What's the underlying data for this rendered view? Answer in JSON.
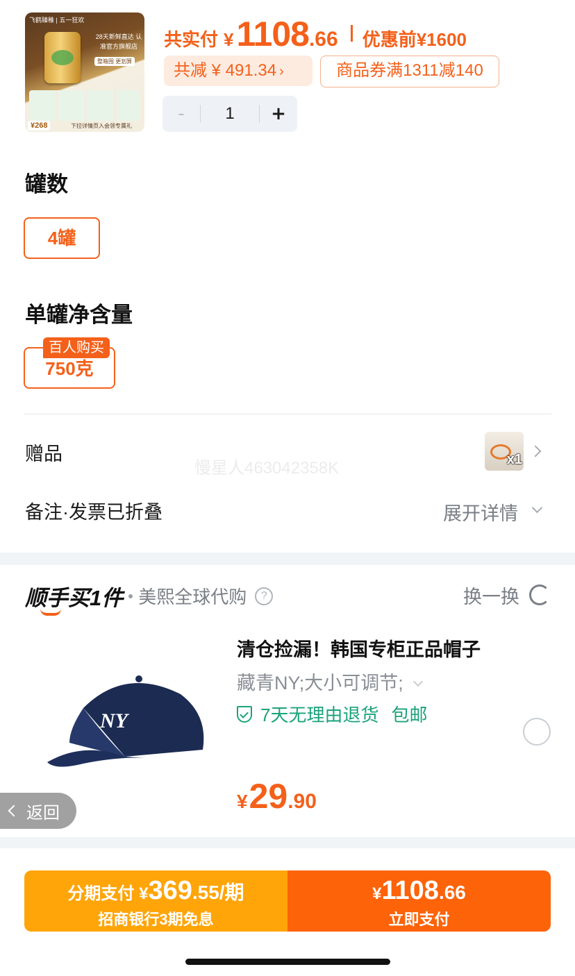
{
  "product_thumb": {
    "brand": "飞鹤臻稚 | 五一狂欢",
    "slogan": "28天新鲜直达 认准官方旗舰店",
    "flag": "整箱囤 更划算",
    "price_tag": "¥268",
    "footer": "下拉详情页入会领专属礼"
  },
  "summary": {
    "paid_label": "共实付",
    "currency": "¥",
    "paid_integer": "1108",
    "paid_decimal": ".66",
    "original_label": "优惠前",
    "original_price": "¥1600",
    "savings": "共减 ¥ 491.34",
    "coupon": "商品券满1311减140",
    "quantity": "1",
    "minus": "-",
    "plus": "+"
  },
  "specs": {
    "count_title": "罐数",
    "count_option": "4罐",
    "weight_title": "单罐净含量",
    "weight_option": "750克",
    "weight_badge": "百人购买"
  },
  "gift": {
    "label": "赠品",
    "quantity": "x1",
    "watermark": "慢星人463042358K"
  },
  "note": {
    "label": "备注·发票已折叠",
    "action": "展开详情"
  },
  "bundle": {
    "title": "顺手买1件",
    "shop": "美熙全球代购",
    "help": "?",
    "swap": "换一换",
    "item": {
      "name": "清仓捡漏！韩国专柜正品帽子",
      "spec": "藏青NY;大小可调节;",
      "return_policy": "7天无理由退货",
      "shipping": "包邮",
      "price_currency": "¥",
      "price_integer": "29",
      "price_decimal": ".90",
      "logo_text": "NY"
    }
  },
  "back": {
    "label": "返回"
  },
  "pay": {
    "install_prefix": "分期支付 ¥",
    "install_integer": "369",
    "install_suffix": ".55/期",
    "install_bank": "招商银行3期免息",
    "now_currency": "¥",
    "now_integer": "1108",
    "now_decimal": ".66",
    "now_label": "立即支付"
  },
  "colors": {
    "accent": "#f4601a",
    "install_bg": "#ffa50a",
    "pay_bg": "#fd6308",
    "green": "#1aa37a"
  }
}
